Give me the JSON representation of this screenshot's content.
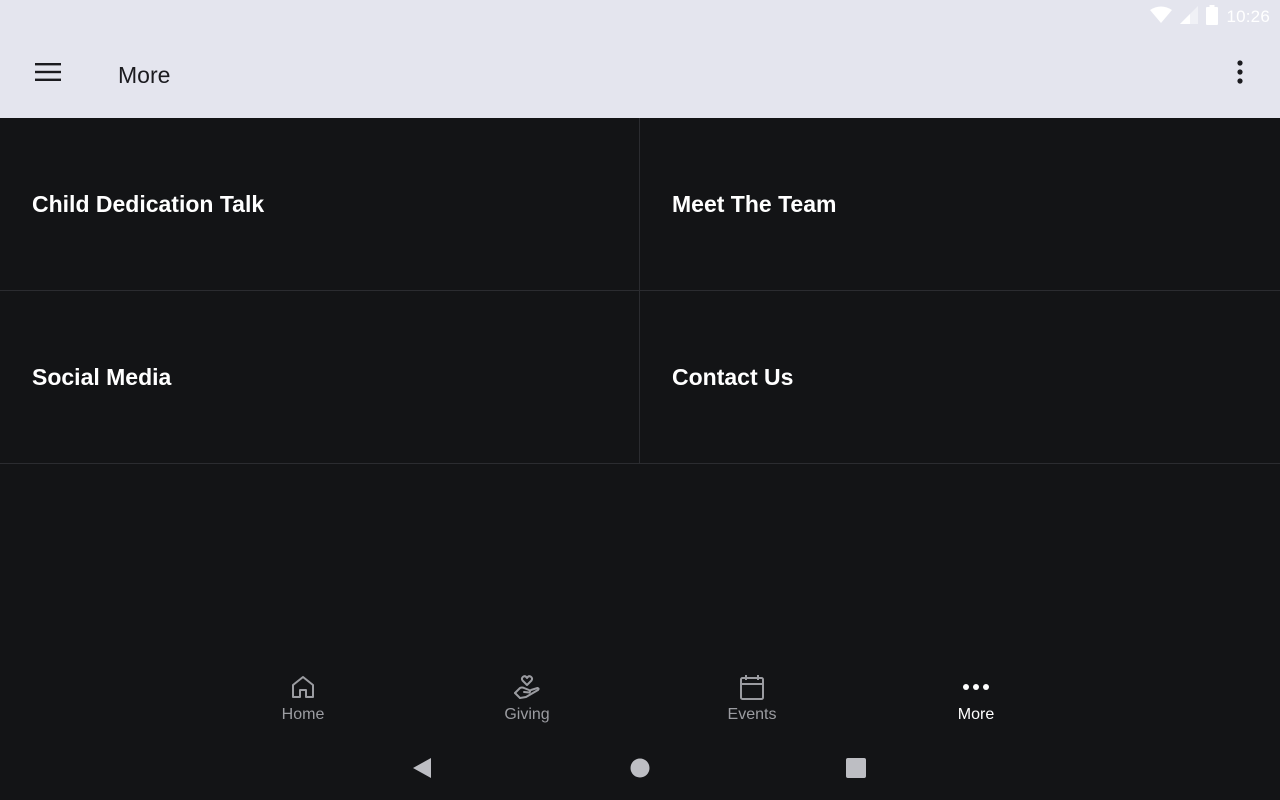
{
  "status_bar": {
    "time": "10:26",
    "icons": [
      "wifi-icon",
      "cell-signal-icon",
      "battery-icon"
    ]
  },
  "app_bar": {
    "title": "More",
    "background": "#e4e5ee"
  },
  "tiles": [
    {
      "label": "Child Dedication Talk"
    },
    {
      "label": "Meet The Team"
    },
    {
      "label": "Social Media"
    },
    {
      "label": "Contact Us"
    }
  ],
  "bottom_nav": {
    "items": [
      {
        "label": "Home",
        "icon": "home-icon",
        "active": false
      },
      {
        "label": "Giving",
        "icon": "giving-hand-heart-icon",
        "active": false
      },
      {
        "label": "Events",
        "icon": "calendar-icon",
        "active": false
      },
      {
        "label": "More",
        "icon": "more-horizontal-icon",
        "active": true
      }
    ],
    "active_color": "#ffffff",
    "inactive_color": "#9b9ca1"
  },
  "system_nav": {
    "icons": [
      "back-icon",
      "home-circle-icon",
      "recents-square-icon"
    ]
  },
  "colors": {
    "background": "#131416",
    "divider": "#2b2c30"
  }
}
